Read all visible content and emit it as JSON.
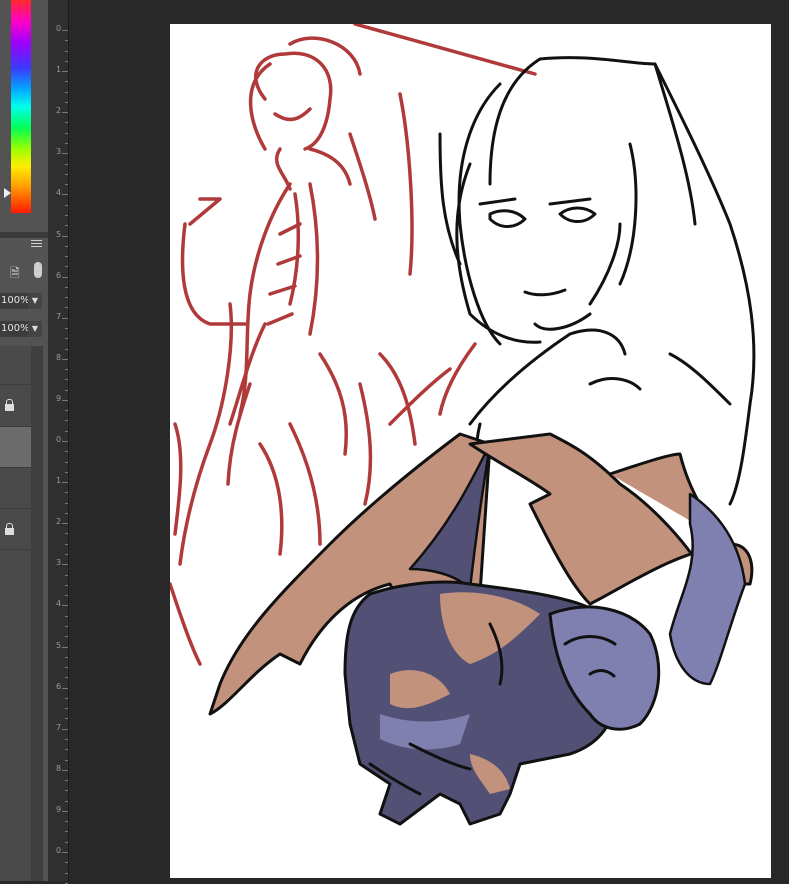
{
  "layers_panel": {
    "opacity_value": "100%",
    "fill_value": "100%"
  },
  "ruler": {
    "labels": [
      "0",
      "1",
      "2",
      "3",
      "4",
      "5",
      "6",
      "7",
      "8",
      "9",
      "0",
      "1",
      "2",
      "3",
      "4",
      "5",
      "6",
      "7",
      "8",
      "9",
      "0"
    ]
  },
  "colors": {
    "panel_bg": "#535353",
    "workspace_bg": "#282828",
    "canvas_bg": "#ffffff",
    "sketch_red": "#b03a3a",
    "ink": "#111111",
    "wing_tan": "#c3927d",
    "body_indigo": "#525175",
    "body_light": "#7f7fb0"
  },
  "icons": [
    "color-ramp",
    "panel-menu-icon",
    "file-lock-icon",
    "toggle-icon",
    "chevron-down-icon",
    "lock-icon"
  ]
}
